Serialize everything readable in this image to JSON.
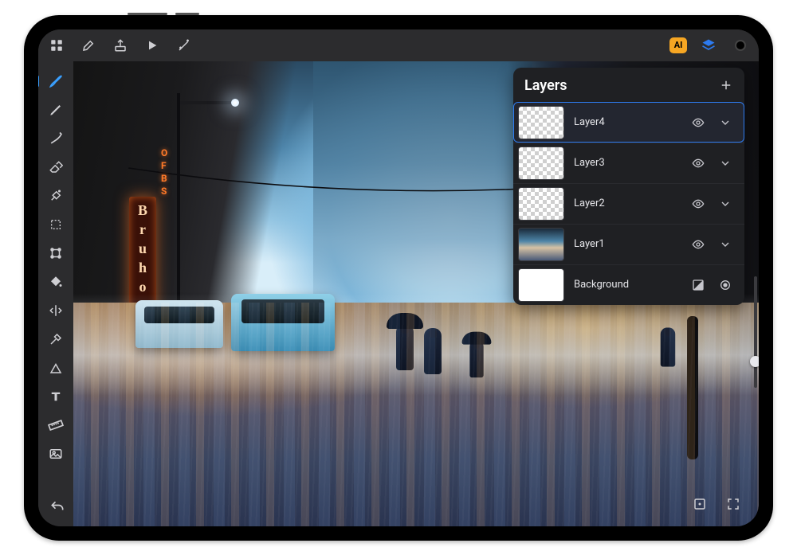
{
  "badge_ai": "AI",
  "sign_vertical": "BruhouZ",
  "sign_small": "OFBS",
  "layers": {
    "title": "Layers",
    "items": [
      {
        "name": "Layer4"
      },
      {
        "name": "Layer3"
      },
      {
        "name": "Layer2"
      },
      {
        "name": "Layer1"
      },
      {
        "name": "Background"
      }
    ]
  }
}
